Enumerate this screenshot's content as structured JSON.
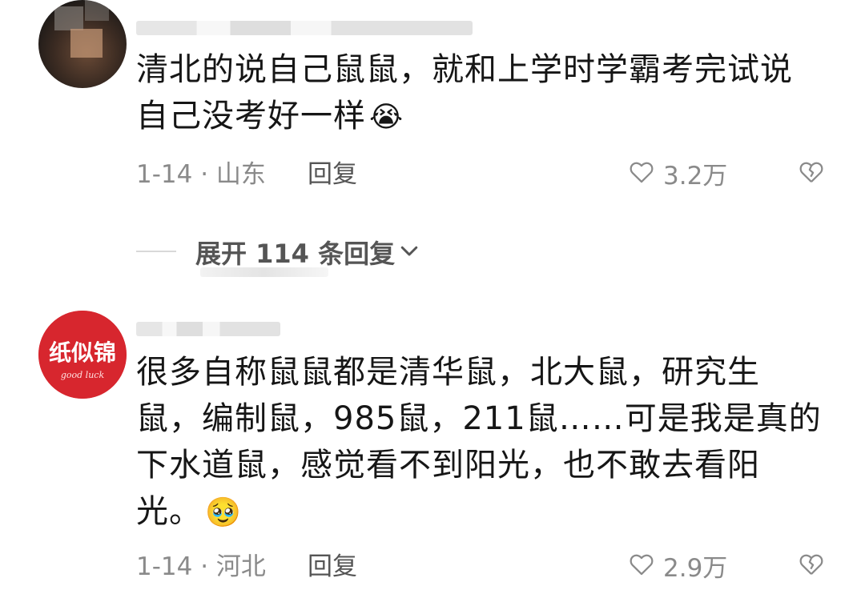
{
  "comments": [
    {
      "text": "清北的说自己鼠鼠，就和上学时学霸考完试说\n自己没考好一样",
      "emoji": "😭",
      "date": "1-14",
      "location": "山东",
      "reply_label": "回复",
      "likes": "3.2万"
    },
    {
      "text": "很多自称鼠鼠都是清华鼠，北大鼠，研究生\n鼠，编制鼠，985鼠，211鼠……可是我是真的\n下水道鼠，感觉看不到阳光，也不敢去看阳\n光。",
      "emoji": "🥹",
      "avatar_text": "纸似锦",
      "avatar_subtext": "good luck",
      "date": "1-14",
      "location": "河北",
      "reply_label": "回复",
      "likes": "2.9万"
    }
  ],
  "expand": {
    "label": "展开 114 条回复"
  },
  "icons": {
    "like": "heart-outline-icon",
    "dislike": "broken-heart-icon",
    "expand": "chevron-down-icon"
  },
  "colors": {
    "text": "#161616",
    "meta": "#8a8a8a",
    "avatar_red": "#d7262e"
  }
}
